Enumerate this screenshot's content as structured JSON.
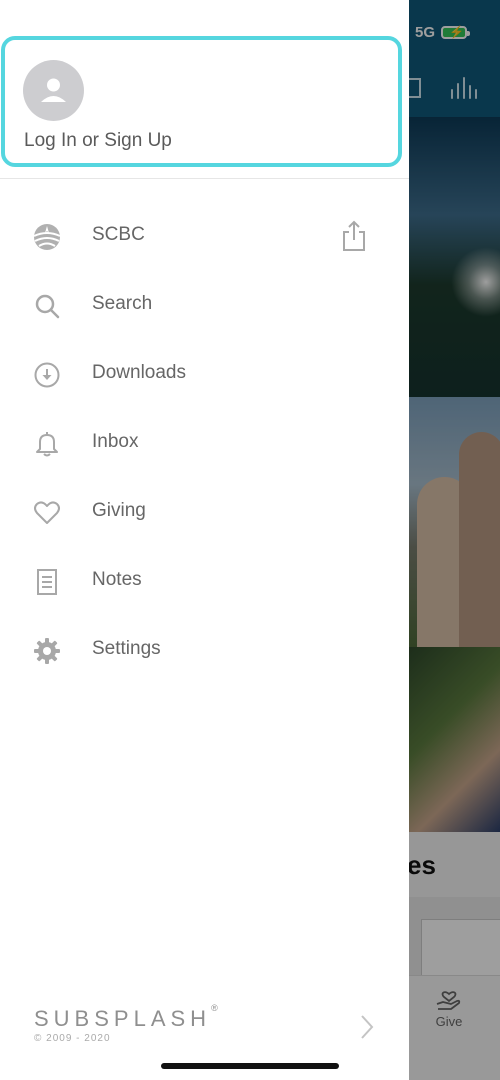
{
  "status_bar": {
    "network": "5G"
  },
  "background_app": {
    "partial_heading": "es",
    "tabbar": {
      "give_label": "Give"
    }
  },
  "drawer": {
    "login": {
      "label": "Log In or Sign Up"
    },
    "menu": [
      {
        "label": "SCBC",
        "icon": "church-logo-icon"
      },
      {
        "label": "Search",
        "icon": "search-icon"
      },
      {
        "label": "Downloads",
        "icon": "download-icon"
      },
      {
        "label": "Inbox",
        "icon": "bell-icon"
      },
      {
        "label": "Giving",
        "icon": "heart-icon"
      },
      {
        "label": "Notes",
        "icon": "notes-icon"
      },
      {
        "label": "Settings",
        "icon": "gear-icon"
      }
    ],
    "footer": {
      "brand": "SUBSPLASH",
      "registered": "®",
      "copyright": "© 2009 - 2020"
    }
  },
  "colors": {
    "accent_outline": "#55d6df",
    "header_bg": "#0f5a7b",
    "battery": "#34c759",
    "icon_gray": "#b0b0b0",
    "label_gray": "#666666"
  }
}
